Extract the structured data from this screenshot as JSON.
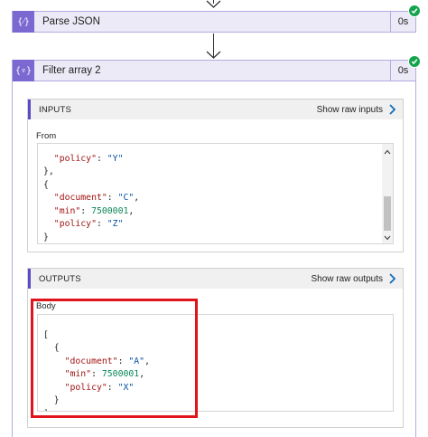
{
  "parse_json_action": {
    "title": "Parse JSON",
    "duration": "0s",
    "icon": "curly-braces-icon",
    "status": "succeeded"
  },
  "filter_action": {
    "title": "Filter array 2",
    "duration": "0s",
    "icon": "filter-braces-icon",
    "status": "succeeded",
    "inputs": {
      "section_title": "INPUTS",
      "show_raw_label": "Show raw inputs",
      "field_label": "From",
      "code_lines": [
        "  \"policy\": \"Y\"",
        "},",
        "{",
        "  \"document\": \"C\",",
        "  \"min\": 7500001,",
        "  \"policy\": \"Z\"",
        "}",
        "]"
      ]
    },
    "outputs": {
      "section_title": "OUTPUTS",
      "show_raw_label": "Show raw outputs",
      "field_label": "Body",
      "code_lines": [
        "[",
        "  {",
        "    \"document\": \"A\",",
        "    \"min\": 7500001,",
        "    \"policy\": \"X\"",
        "  }",
        "]"
      ]
    }
  },
  "colors": {
    "action_accent": "#7b68d0",
    "header_bg": "#eceaf6",
    "success": "#14a44d",
    "highlight": "#e0151b",
    "link_chevron": "#0f6cbd"
  }
}
